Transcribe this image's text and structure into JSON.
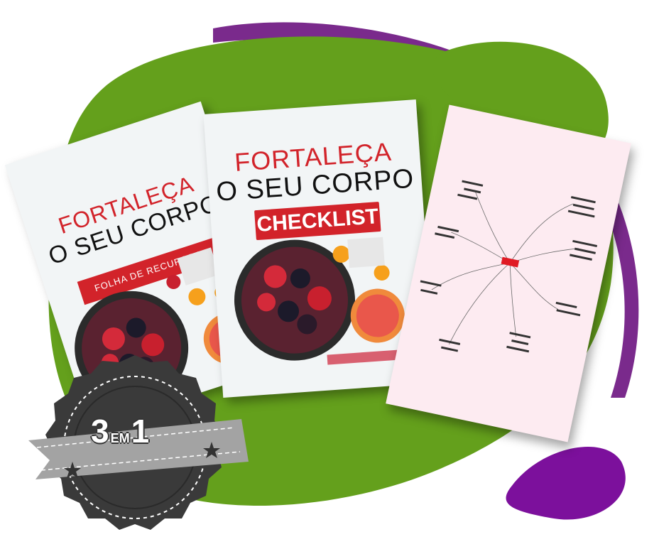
{
  "colors": {
    "green_blob": "#64a01c",
    "purple_accent": "#7a2a8c",
    "purple_small_blob": "#7c109c",
    "red_band": "#d2232a",
    "badge_dark": "#3a3a3a",
    "ribbon_gray": "#a3a3a3"
  },
  "books": {
    "resources": {
      "title_line1": "FORTALEÇA",
      "title_line2": "O SEU CORPO",
      "band_label": "FOLHA DE RECURSOS"
    },
    "checklist": {
      "title_line1": "FORTALEÇA",
      "title_line2": "O SEU CORPO",
      "band_label": "CHECKLIST"
    },
    "mindmap": {
      "icon": "mindmap-diagram"
    }
  },
  "badge": {
    "number_left": "3",
    "connector": "EM",
    "number_right": "1",
    "stars_icon": "star-icon"
  }
}
